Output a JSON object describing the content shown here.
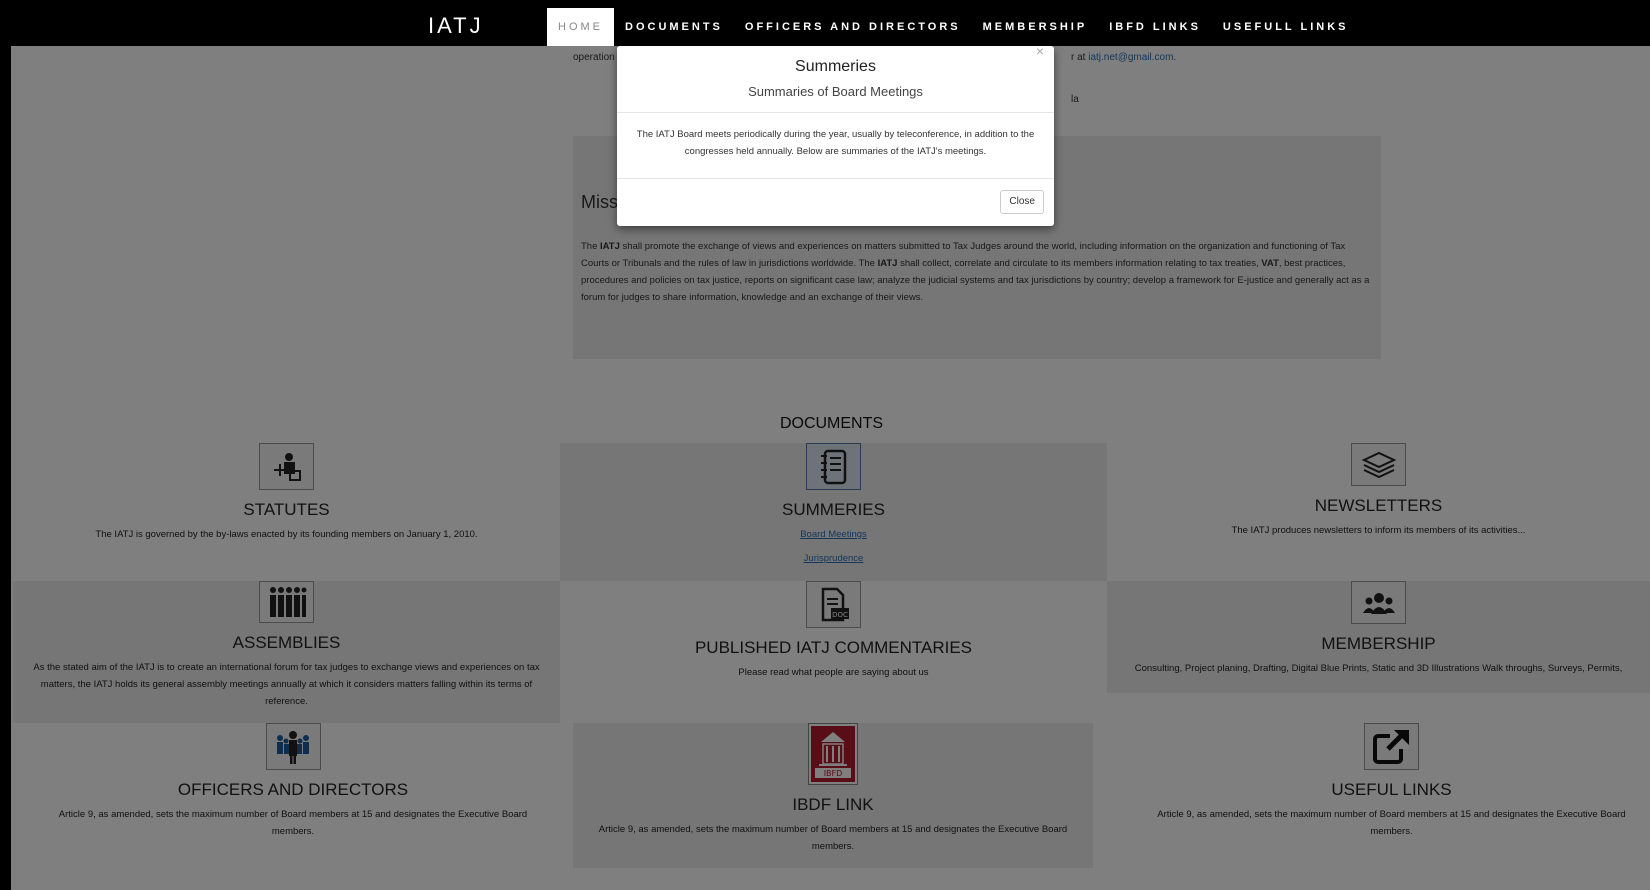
{
  "navbar": {
    "brand": "IATJ",
    "items": [
      "HOME",
      "DOCUMENTS",
      "OFFICERS AND DIRECTORS",
      "MEMBERSHIP",
      "IBFD LINKS",
      "USEFULL LINKS"
    ],
    "active": "HOME"
  },
  "intro": {
    "left_text": "operation",
    "right_text_prefix": "r at ",
    "email": "iatj.net@gmail.com.",
    "right_text_2": "la"
  },
  "mission": {
    "heading": "Miss",
    "text_parts": [
      {
        "t": "The "
      },
      {
        "b": "IATJ"
      },
      {
        "t": " shall promote the exchange of views and experiences on matters submitted to Tax Judges around the world, including information on the organization and functioning of Tax Courts or Tribunals and the rules of law in jurisdictions worldwide. The "
      },
      {
        "b": "IATJ"
      },
      {
        "t": " shall collect, correlate and circulate to its members information relating to tax treaties, "
      },
      {
        "b": "VAT"
      },
      {
        "t": ", best practices, procedures and policies on tax justice, reports on significant case law; analyze the judicial systems and tax jurisdictions by country; develop a framework for E-justice and generally act as a forum for judges to share information, knowledge and an exchange of their views."
      }
    ]
  },
  "documents": {
    "title": "DOCUMENTS",
    "cells": {
      "statutes": {
        "title": "STATUTES",
        "desc": "The IATJ is governed by the by-laws enacted by its founding members on January 1, 2010.",
        "icon": "judge-icon"
      },
      "summeries": {
        "title": "SUMMERIES",
        "links": [
          "Board Meetings",
          "Jurisprudence"
        ],
        "icon": "notebook-icon"
      },
      "newsletters": {
        "title": "NEWSLETTERS",
        "desc": "The IATJ produces newsletters to inform its members of its activities...",
        "icon": "stack-icon"
      },
      "assemblies": {
        "title": "ASSEMBLIES",
        "desc": "As the stated aim of the IATJ is to create an international forum for tax judges to exchange views and experiences on tax matters, the IATJ holds its general assembly meetings annually at which it considers matters falling within its terms of reference.",
        "icon": "group-icon"
      },
      "commentaries": {
        "title": "PUBLISHED IATJ COMMENTARIES",
        "desc": "Please read what people are saying about us",
        "icon": "doc-icon"
      },
      "membership": {
        "title": "MEMBERSHIP",
        "desc": "Consulting, Project planing, Drafting, Digital Blue Prints, Static and 3D Illustrations Walk throughs, Surveys, Permits,",
        "icon": "people-icon"
      },
      "officers": {
        "title": "OFFICERS AND DIRECTORS",
        "desc": "Article 9, as amended, sets the maximum number of Board members at 15 and designates the Executive Board members.",
        "icon": "directors-icon"
      },
      "ibdf": {
        "title": "IBDF LINK",
        "desc": "Article 9, as amended, sets the maximum number of Board members at 15 and designates the Executive Board members.",
        "icon": "ibfd-logo-icon",
        "logo_text": "IBFD"
      },
      "useful": {
        "title": "USEFUL LINKS",
        "desc": "Article 9, as amended, sets the maximum number of Board members at 15 and designates the Executive Board members.",
        "icon": "external-link-icon"
      }
    }
  },
  "modal": {
    "title": "Summeries",
    "subtitle": "Summaries of Board Meetings",
    "body": "The IATJ Board meets periodically during the year, usually by teleconference, in addition to the congresses held annually. Below are summaries of the IATJ's meetings.",
    "close_label": "Close",
    "close_x": "×"
  },
  "colors": {
    "navbar_bg": "#000000",
    "link": "#2a6fb8",
    "overlay": "rgba(0,0,0,0.5)"
  }
}
